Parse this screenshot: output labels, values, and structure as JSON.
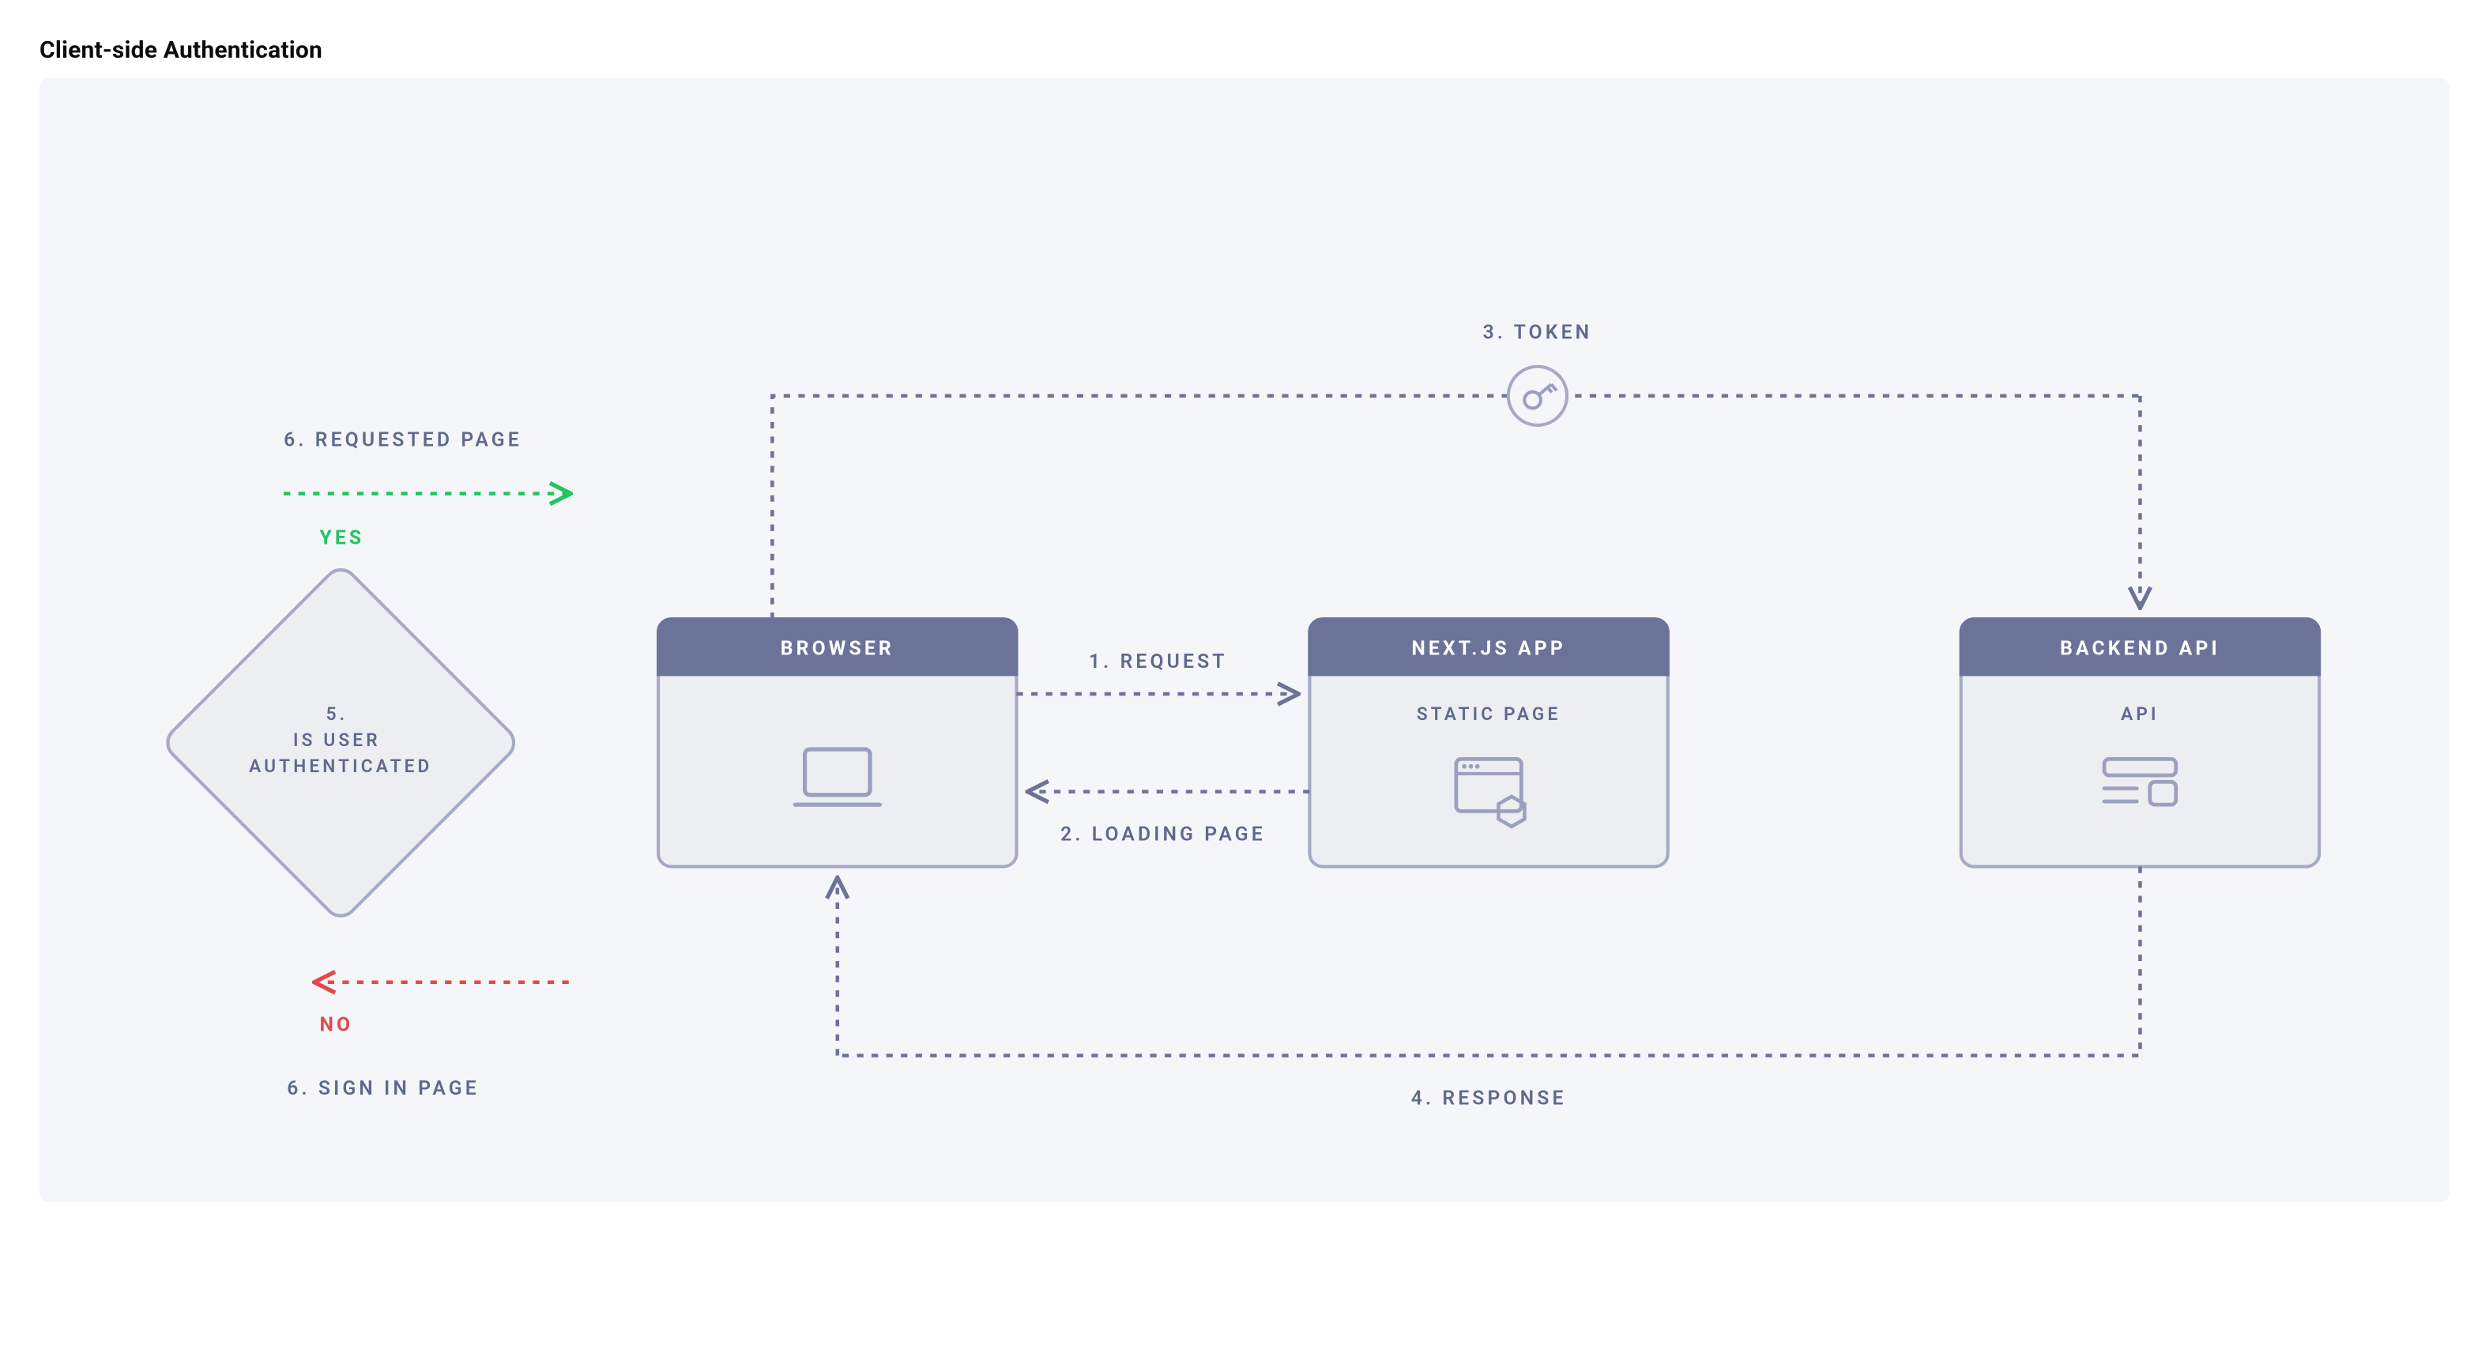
{
  "title": "Client-side Authentication",
  "nodes": {
    "browser": {
      "title": "BROWSER",
      "sub": ""
    },
    "nextapp": {
      "title": "NEXT.JS APP",
      "sub": "STATIC PAGE"
    },
    "backend": {
      "title": "BACKEND API",
      "sub": "API"
    }
  },
  "decision": {
    "line1": "5.",
    "line2": "IS USER",
    "line3": "AUTHENTICATED"
  },
  "labels": {
    "request": "1. REQUEST",
    "loading": "2. LOADING PAGE",
    "token": "3. TOKEN",
    "response": "4. RESPONSE",
    "requestedPage": "6. REQUESTED PAGE",
    "signinPage": "6. SIGN IN PAGE"
  },
  "branches": {
    "yes": "YES",
    "no": "NO"
  },
  "chart_data": {
    "type": "flow-diagram",
    "title": "Client-side Authentication",
    "nodes": [
      {
        "id": "browser",
        "kind": "component",
        "label": "BROWSER"
      },
      {
        "id": "nextapp",
        "kind": "component",
        "label": "NEXT.JS APP",
        "sublabel": "STATIC PAGE"
      },
      {
        "id": "backend",
        "kind": "component",
        "label": "BACKEND API",
        "sublabel": "API"
      },
      {
        "id": "decision",
        "kind": "decision",
        "label": "5. IS USER AUTHENTICATED"
      }
    ],
    "edges": [
      {
        "step": 1,
        "from": "browser",
        "to": "nextapp",
        "label": "1. REQUEST"
      },
      {
        "step": 2,
        "from": "nextapp",
        "to": "browser",
        "label": "2. LOADING PAGE"
      },
      {
        "step": 3,
        "from": "browser",
        "to": "backend",
        "label": "3. TOKEN",
        "note": "via token/key"
      },
      {
        "step": 4,
        "from": "backend",
        "to": "browser",
        "label": "4. RESPONSE"
      },
      {
        "step": 5,
        "from": "browser",
        "to": "decision",
        "label": ""
      },
      {
        "step": 6,
        "from": "decision",
        "to": "requested-page",
        "condition": "YES",
        "label": "6. REQUESTED PAGE",
        "color": "green"
      },
      {
        "step": 6,
        "from": "decision",
        "to": "sign-in-page",
        "condition": "NO",
        "label": "6. SIGN IN PAGE",
        "color": "red"
      }
    ]
  }
}
